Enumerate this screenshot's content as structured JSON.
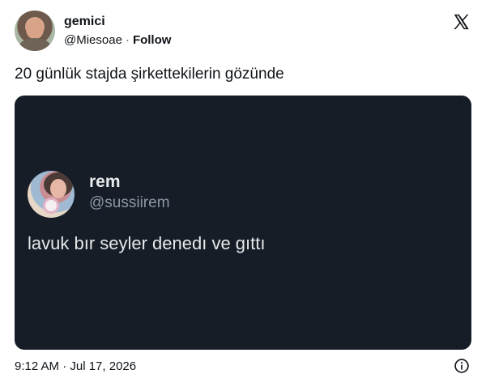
{
  "author": {
    "display_name": "gemici",
    "handle": "@Miesoae",
    "separator": "·",
    "follow_label": "Follow",
    "avatar_icon": "user-avatar"
  },
  "platform_icon": "x-logo-icon",
  "tweet": {
    "text": "20 günlük stajda şirkettekilerin gözünde"
  },
  "embedded": {
    "display_name": "rem",
    "handle": "@sussiirem",
    "text": "lavuk bır seyler denedı ve gıttı",
    "background": "#161d27"
  },
  "footer": {
    "timestamp": "9:12 AM · Jul 17, 2026",
    "info_icon": "info-icon"
  }
}
